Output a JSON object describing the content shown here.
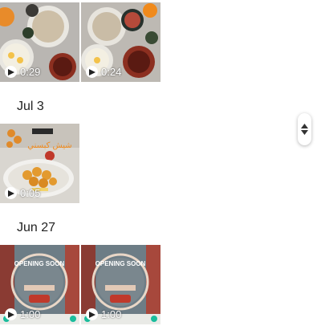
{
  "sections": [
    {
      "date": "",
      "items": [
        {
          "duration": "0:29",
          "subject": "food-spread"
        },
        {
          "duration": "0:24",
          "subject": "food-spread"
        }
      ]
    },
    {
      "date": "Jul 3",
      "items": [
        {
          "duration": "0:05",
          "subject": "fried-dish",
          "caption": "شيش كبسني"
        }
      ]
    },
    {
      "date": "Jun 27",
      "items": [
        {
          "duration": "1:00",
          "subject": "opening-soon",
          "caption": "OPENING SOON"
        },
        {
          "duration": "1:00",
          "subject": "opening-soon",
          "caption": "OPENING SOON"
        }
      ]
    }
  ],
  "colors": {
    "accent_orange": "#f08a1c",
    "date_text": "#222222"
  },
  "icons": {
    "play": "play-icon",
    "scroller": "fast-scroll-handle"
  }
}
